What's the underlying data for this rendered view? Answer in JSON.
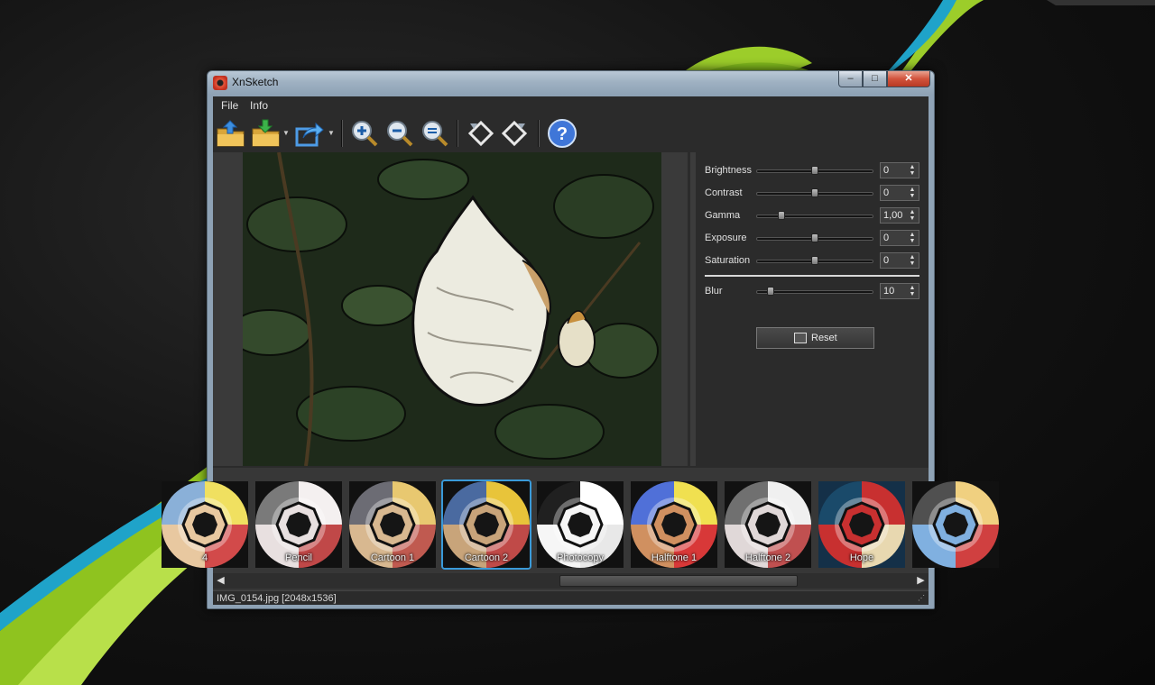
{
  "window": {
    "title": "XnSketch",
    "min_symbol": "–",
    "max_symbol": "□",
    "close_symbol": "✕"
  },
  "menu": {
    "items": [
      {
        "label": "File"
      },
      {
        "label": "Info"
      }
    ]
  },
  "toolbar": {
    "buttons": [
      {
        "icon": "open-folder-icon"
      },
      {
        "icon": "save-folder-icon"
      },
      {
        "icon": "share-icon"
      },
      {
        "icon": "zoom-in-icon"
      },
      {
        "icon": "zoom-out-icon"
      },
      {
        "icon": "zoom-fit-icon"
      },
      {
        "icon": "rotate-left-icon"
      },
      {
        "icon": "rotate-right-icon"
      },
      {
        "icon": "help-icon"
      }
    ],
    "dropdown_arrow": "▼"
  },
  "adjustments": {
    "brightness": {
      "label": "Brightness",
      "value": "0",
      "level": 0.5
    },
    "contrast": {
      "label": "Contrast",
      "value": "0",
      "level": 0.5
    },
    "gamma": {
      "label": "Gamma",
      "value": "1,00",
      "level": 0.2
    },
    "exposure": {
      "label": "Exposure",
      "value": "0",
      "level": 0.5
    },
    "saturation": {
      "label": "Saturation",
      "value": "0",
      "level": 0.5
    },
    "blur": {
      "label": "Blur",
      "value": "10",
      "level": 0.1
    },
    "spin_up": "▲",
    "spin_down": "▼"
  },
  "reset": {
    "label": "Reset"
  },
  "filters": [
    {
      "label": "4"
    },
    {
      "label": "Pencil"
    },
    {
      "label": "Cartoon 1"
    },
    {
      "label": "Cartoon 2",
      "selected": true
    },
    {
      "label": "Photocopy"
    },
    {
      "label": "Halftone 1"
    },
    {
      "label": "Halftone 2"
    },
    {
      "label": "Hope"
    },
    {
      "label": ""
    }
  ],
  "scroll": {
    "left": "◀",
    "right": "▶"
  },
  "status": {
    "text": "IMG_0154.jpg [2048x1536]",
    "grip": "⋰"
  },
  "colors": {
    "accent": "#3a9ad9",
    "background": "#2b2b2b"
  }
}
